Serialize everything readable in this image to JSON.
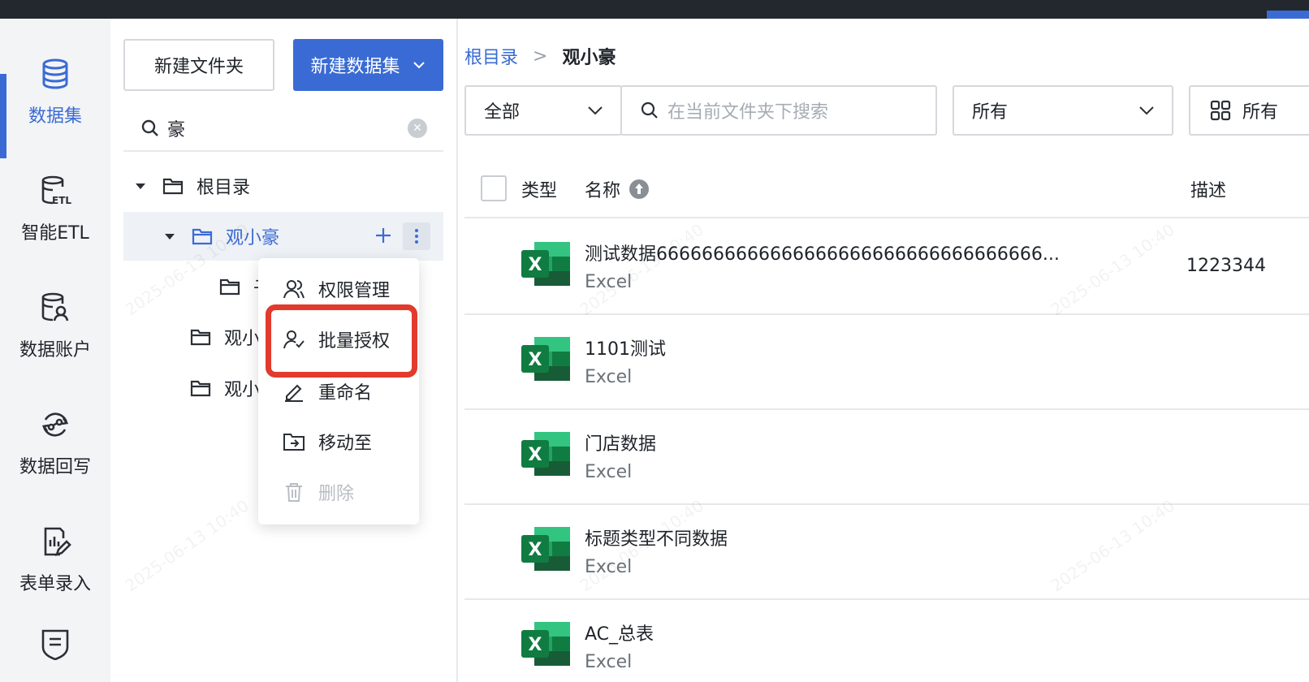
{
  "rail": {
    "items": [
      {
        "label": "数据集",
        "icon": "database-icon"
      },
      {
        "label": "智能ETL",
        "icon": "etl-icon"
      },
      {
        "label": "数据账户",
        "icon": "data-account-icon"
      },
      {
        "label": "数据回写",
        "icon": "data-writeback-icon"
      },
      {
        "label": "表单录入",
        "icon": "form-entry-icon"
      },
      {
        "label": "",
        "icon": "shield-doc-icon"
      }
    ]
  },
  "tree_panel": {
    "new_folder_label": "新建文件夹",
    "new_dataset_label": "新建数据集",
    "search_value": "豪",
    "nodes": [
      {
        "label": "根目录"
      },
      {
        "label": "观小豪"
      },
      {
        "label": "子"
      },
      {
        "label": "观小"
      },
      {
        "label": "观小"
      }
    ]
  },
  "context_menu": {
    "items": [
      {
        "label": "权限管理",
        "icon": "users-icon"
      },
      {
        "label": "批量授权",
        "icon": "user-check-icon"
      },
      {
        "label": "重命名",
        "icon": "edit-icon"
      },
      {
        "label": "移动至",
        "icon": "move-folder-icon"
      },
      {
        "label": "删除",
        "icon": "trash-icon",
        "disabled": true
      }
    ]
  },
  "breadcrumb": {
    "root": "根目录",
    "separator": ">",
    "current": "观小豪"
  },
  "filters": {
    "type_value": "全部",
    "search_placeholder": "在当前文件夹下搜索",
    "owner_value": "所有",
    "view_value": "所有"
  },
  "table": {
    "headers": {
      "type": "类型",
      "name": "名称",
      "description": "描述"
    },
    "rows": [
      {
        "name": "测试数据6666666666666666666666666666666666...",
        "type": "Excel",
        "description": "1223344"
      },
      {
        "name": "1101测试",
        "type": "Excel",
        "description": ""
      },
      {
        "name": "门店数据",
        "type": "Excel",
        "description": ""
      },
      {
        "name": "标题类型不同数据",
        "type": "Excel",
        "description": ""
      },
      {
        "name": "AC_总表",
        "type": "Excel",
        "description": ""
      }
    ]
  },
  "colors": {
    "accent": "#3a6bd4",
    "highlight": "#e23a2c",
    "excel_green": "#1e7145"
  }
}
